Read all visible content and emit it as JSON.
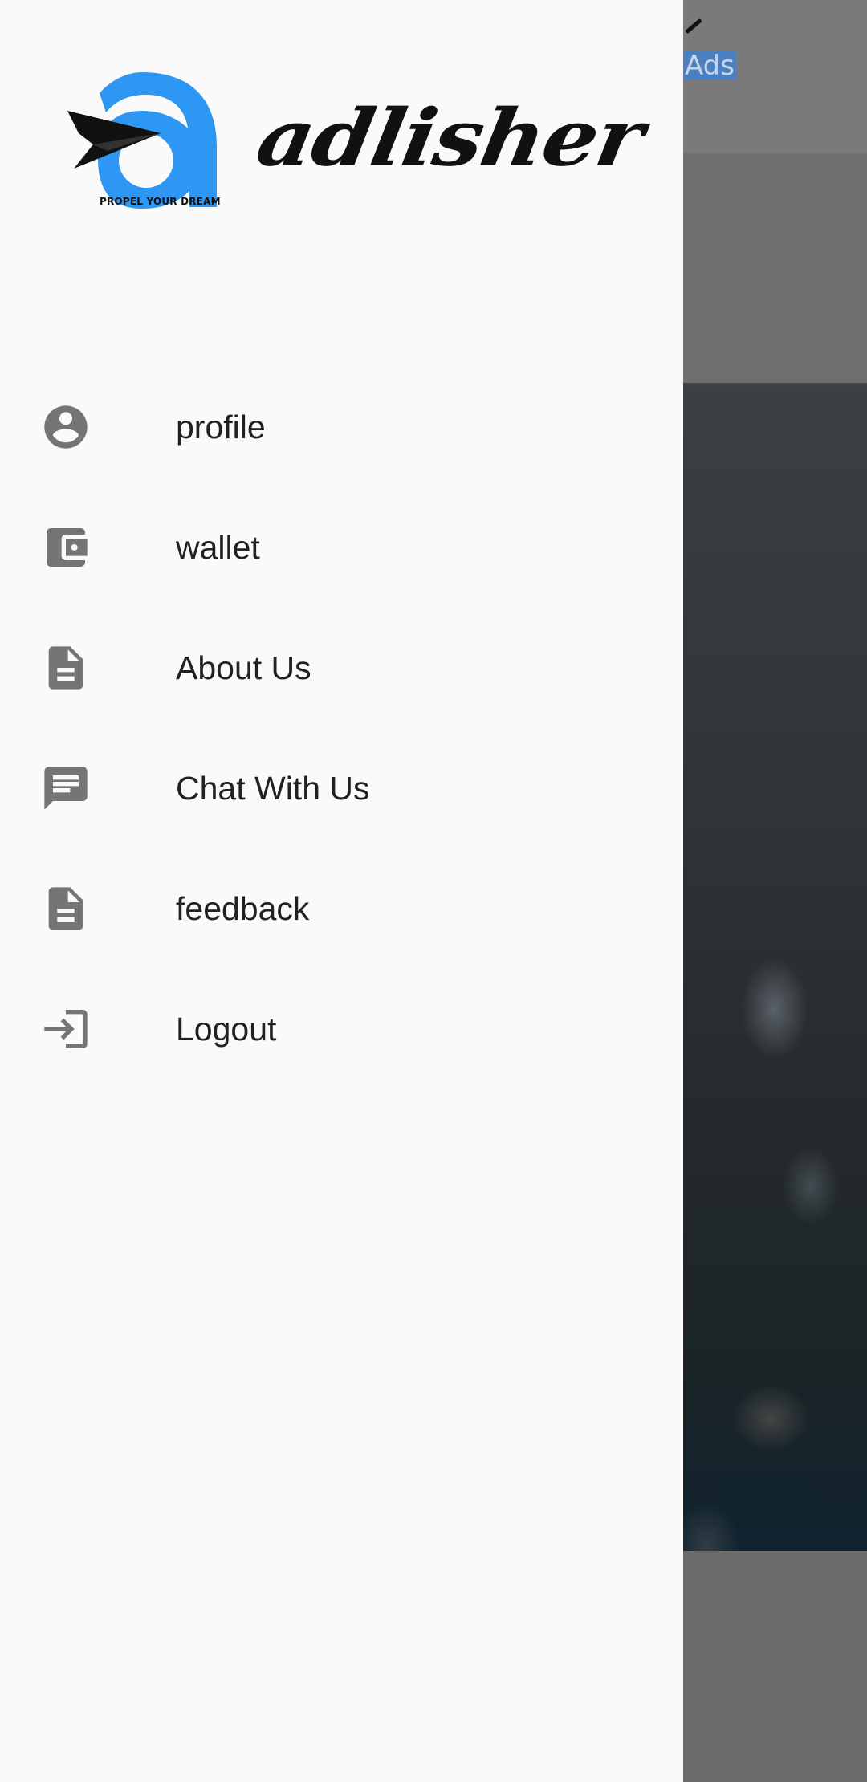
{
  "background_app": {
    "title_fragment": "Ads"
  },
  "drawer": {
    "logo": {
      "tagline": "PROPEL YOUR DREAM",
      "brand": "adlisher"
    },
    "items": [
      {
        "label": "profile",
        "icon": "account-circle-icon"
      },
      {
        "label": "wallet",
        "icon": "wallet-icon"
      },
      {
        "label": "About Us",
        "icon": "document-icon"
      },
      {
        "label": "Chat With Us",
        "icon": "chat-icon"
      },
      {
        "label": "feedback",
        "icon": "document-icon"
      },
      {
        "label": "Logout",
        "icon": "logout-icon"
      }
    ]
  },
  "colors": {
    "drawer_background": "#fafafa",
    "icon_gray": "#757575",
    "text_primary": "#212121",
    "logo_blue": "#2d97f3",
    "scrim": "#6b6b6b"
  }
}
